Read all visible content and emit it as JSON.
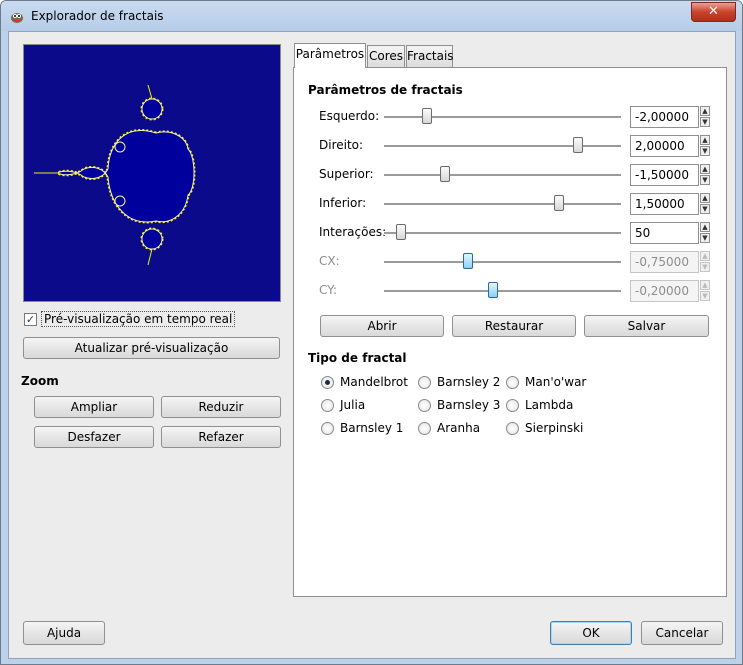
{
  "window": {
    "title": "Explorador de fractais",
    "close_glyph": "✕"
  },
  "left": {
    "realtime_preview": {
      "label": "Pré-visualização em tempo real",
      "checked": true,
      "check_glyph": "✓"
    },
    "update_preview_label": "Atualizar pré-visualização",
    "zoom": {
      "title": "Zoom",
      "zoom_in": "Ampliar",
      "zoom_out": "Reduzir",
      "undo": "Desfazer",
      "redo": "Refazer"
    }
  },
  "tabs": [
    {
      "label": "Parâmetros",
      "active": true
    },
    {
      "label": "Cores"
    },
    {
      "label": "Fractais"
    }
  ],
  "params": {
    "title": "Parâmetros de fractais",
    "rows": [
      {
        "label": "Esquerdo:",
        "value": "-2,00000",
        "level": 0.18,
        "enabled": true
      },
      {
        "label": "Direito:",
        "value": "2,00000",
        "level": 0.82,
        "enabled": true
      },
      {
        "label": "Superior:",
        "value": "-1,50000",
        "level": 0.25,
        "enabled": true
      },
      {
        "label": "Inferior:",
        "value": "1,50000",
        "level": 0.74,
        "enabled": true
      },
      {
        "label": "Interações:",
        "value": "50",
        "level": 0.05,
        "enabled": true
      },
      {
        "label": "CX:",
        "value": "-0,75000",
        "level": 0.35,
        "enabled": false
      },
      {
        "label": "CY:",
        "value": "-0,20000",
        "level": 0.46,
        "enabled": false
      }
    ],
    "buttons": {
      "open": "Abrir",
      "reset": "Restaurar",
      "save": "Salvar"
    }
  },
  "fractal_type": {
    "title": "Tipo de fractal",
    "options": [
      "Mandelbrot",
      "Julia",
      "Barnsley 1",
      "Barnsley 2",
      "Barnsley 3",
      "Aranha",
      "Man'o'war",
      "Lambda",
      "Sierpinski"
    ],
    "selected": "Mandelbrot"
  },
  "footer": {
    "help": "Ajuda",
    "ok": "OK",
    "cancel": "Cancelar"
  },
  "colors": {
    "fractal_background": "#0a0a8a",
    "fractal_set": "#00009c",
    "fractal_edge": "#f4f000"
  }
}
